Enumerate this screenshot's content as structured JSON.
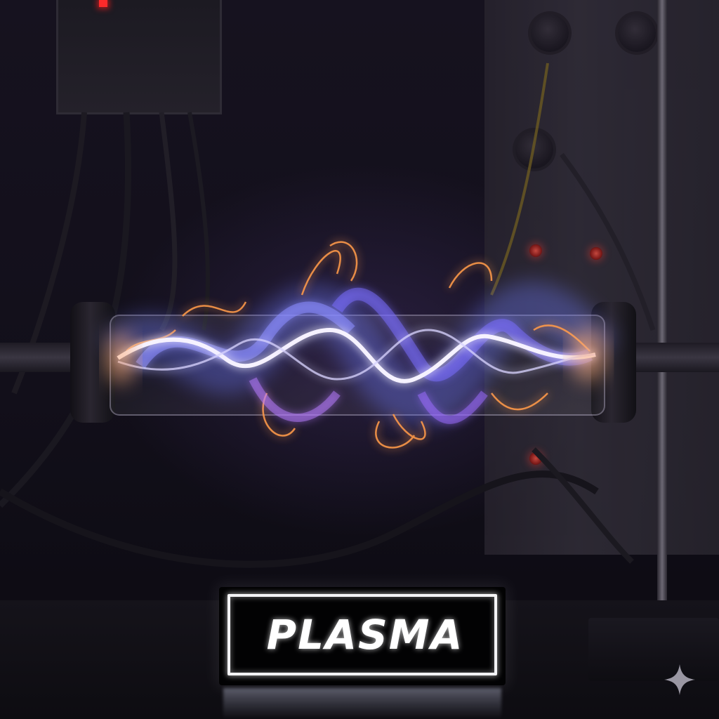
{
  "sign": {
    "label": "PLASMA"
  },
  "icons": {
    "sparkle": "sparkle-icon"
  },
  "colors": {
    "plasma_blue": "#6f7dff",
    "plasma_violet": "#b77bff",
    "plasma_orange": "#ff9a4a",
    "plasma_core": "#f6f2ff",
    "sign_text": "#ffffff",
    "indicator_red": "#ff3a2e"
  }
}
